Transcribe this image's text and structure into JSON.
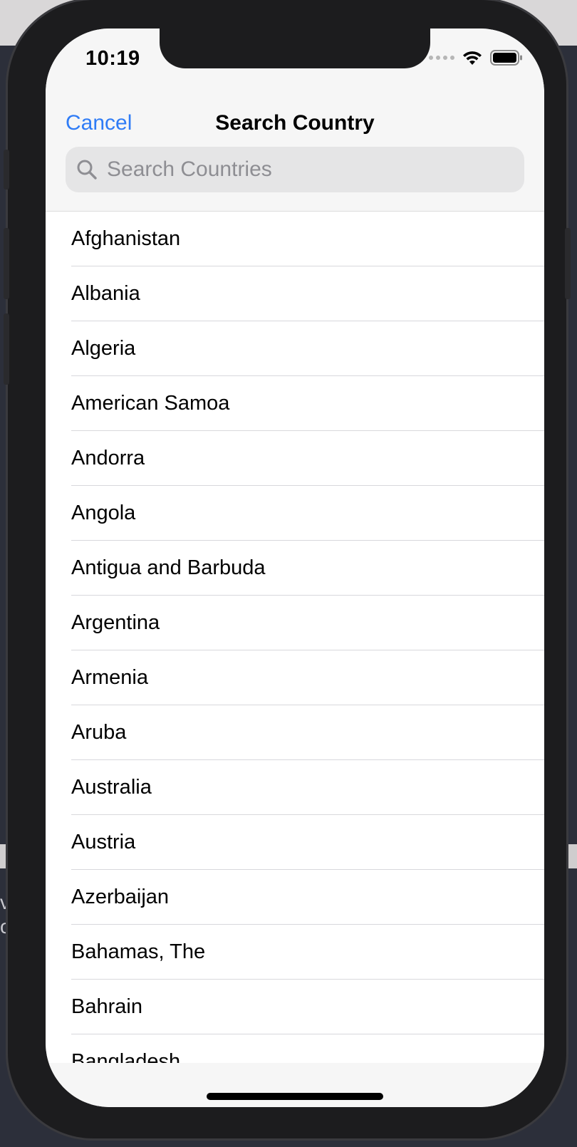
{
  "status_bar": {
    "time": "10:19",
    "icons": [
      "cellular-signal-icon",
      "wifi-icon",
      "battery-icon"
    ]
  },
  "nav": {
    "cancel_label": "Cancel",
    "title": "Search Country"
  },
  "search": {
    "placeholder": "Search Countries",
    "value": ""
  },
  "countries": [
    "Afghanistan",
    "Albania",
    "Algeria",
    "American Samoa",
    "Andorra",
    "Angola",
    "Antigua and Barbuda",
    "Argentina",
    "Armenia",
    "Aruba",
    "Australia",
    "Austria",
    "Azerbaijan",
    "Bahamas, The",
    "Bahrain",
    "Bangladesh"
  ],
  "colors": {
    "accent": "#2f7cf6",
    "header_bg": "#f6f6f6",
    "search_bg": "#e5e5e6",
    "placeholder": "#8e8e93",
    "separator": "#d8d8dc"
  }
}
